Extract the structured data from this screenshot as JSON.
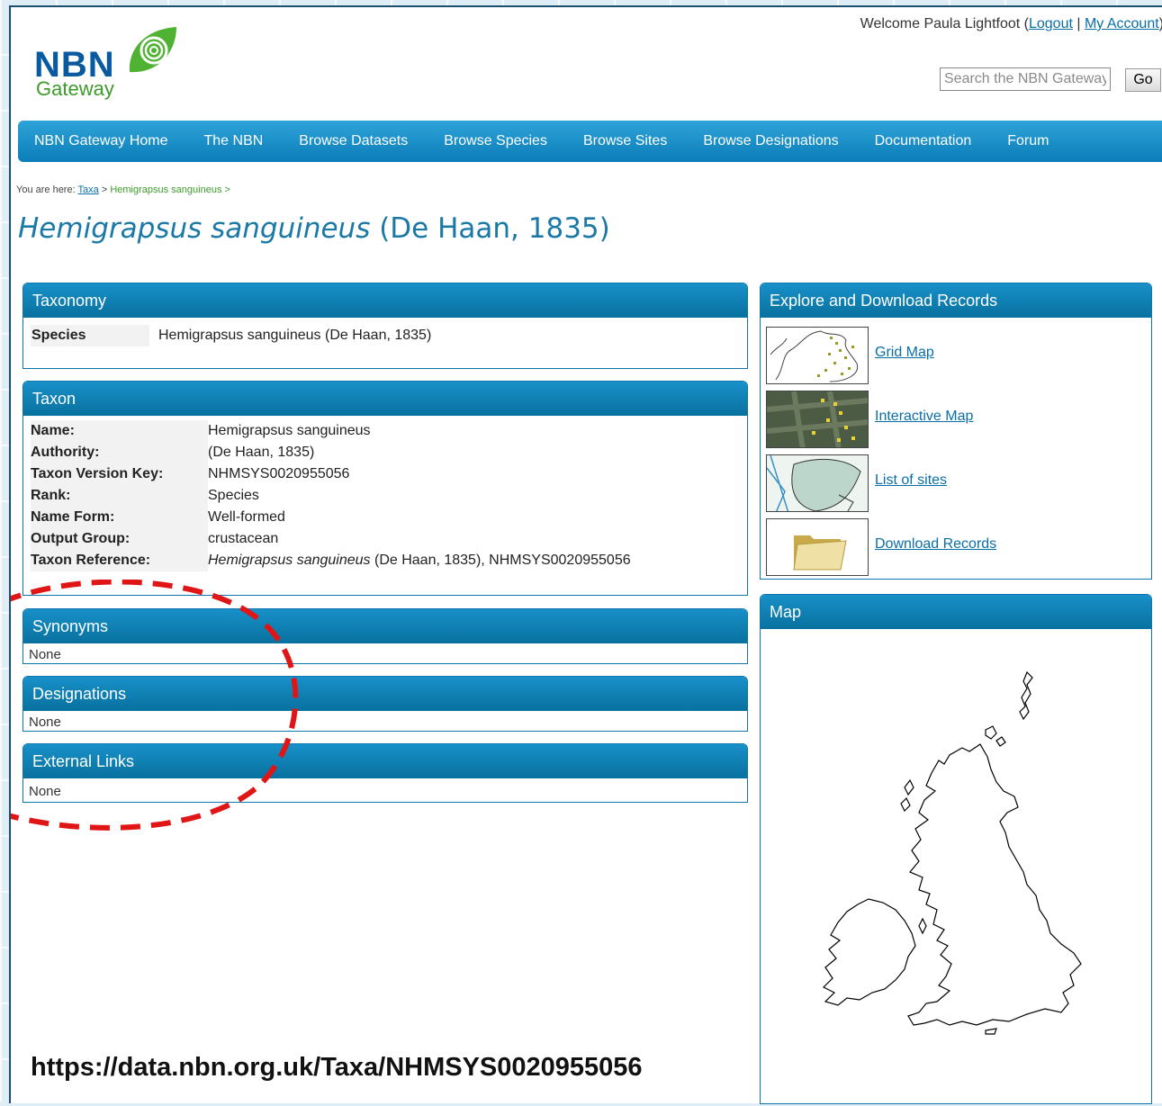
{
  "header": {
    "logo_main": "NBN",
    "logo_sub": "Gateway",
    "welcome_prefix": "Welcome Paula Lightfoot (",
    "logout_label": "Logout",
    "separator": " | ",
    "my_account_label": "My Account",
    "welcome_suffix": ")",
    "search_placeholder": "Search the NBN Gateway",
    "go_label": "Go"
  },
  "nav": {
    "items": [
      "NBN Gateway Home",
      "The NBN",
      "Browse Datasets",
      "Browse Species",
      "Browse Sites",
      "Browse Designations",
      "Documentation",
      "Forum"
    ]
  },
  "breadcrumb": {
    "prefix": "You are here: ",
    "taxa_link": "Taxa",
    "sep1": " > ",
    "current": "Hemigrapsus sanguineus",
    "sep2": " >"
  },
  "title": {
    "species_italic": "Hemigrapsus sanguineus",
    "authority": " (De Haan, 1835)"
  },
  "taxonomy": {
    "heading": "Taxonomy",
    "rank_label": "Species",
    "rank_value": "Hemigrapsus sanguineus (De Haan, 1835)"
  },
  "taxon": {
    "heading": "Taxon",
    "rows": [
      {
        "key": "Name:",
        "value": "Hemigrapsus sanguineus"
      },
      {
        "key": "Authority:",
        "value": "(De Haan, 1835)"
      },
      {
        "key": "Taxon Version Key:",
        "value": "NHMSYS0020955056"
      },
      {
        "key": "Rank:",
        "value": "Species"
      },
      {
        "key": "Name Form:",
        "value": "Well-formed"
      },
      {
        "key": "Output Group:",
        "value": "crustacean"
      }
    ],
    "ref_key": "Taxon Reference:",
    "ref_italic": "Hemigrapsus sanguineus",
    "ref_rest": " (De Haan, 1835), NHMSYS0020955056"
  },
  "synonyms": {
    "heading": "Synonyms",
    "value": "None"
  },
  "designations": {
    "heading": "Designations",
    "value": "None"
  },
  "external_links": {
    "heading": "External Links",
    "value": "None"
  },
  "explore": {
    "heading": "Explore and Download Records",
    "links": [
      "Grid Map",
      "Interactive Map",
      "List of sites",
      "Download Records"
    ]
  },
  "map": {
    "heading": "Map"
  },
  "caption": "https://data.nbn.org.uk/Taxa/NHMSYS0020955056",
  "colors": {
    "brand_blue": "#0b7db9",
    "highlight_red": "#e01616",
    "title_blue": "#1a79a7"
  }
}
